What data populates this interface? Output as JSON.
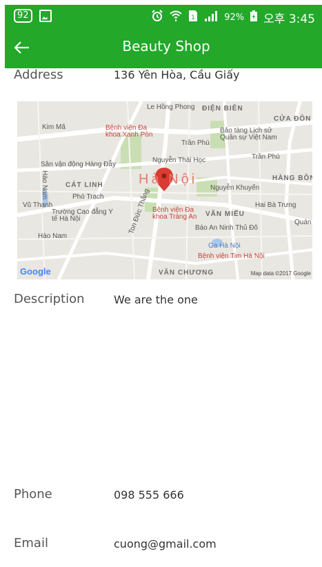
{
  "status_bar": {
    "notif_badge": "92",
    "battery_percent": "92%",
    "time": "오후 3:45"
  },
  "app_bar": {
    "title": "Beauty Shop"
  },
  "details": {
    "address_label": "Address",
    "address_value": "136 Yên Hòa, Cầu Giấy",
    "description_label": "Description",
    "description_value": "We are the one",
    "phone_label": "Phone",
    "phone_value": "098 555 666",
    "email_label": "Email",
    "email_value": "cuong@gmail.com"
  },
  "map": {
    "labels": {
      "le_hong_phong": "Le Hồng Phong",
      "dien_bien": "ĐIỆN BIÊN",
      "cua_dong": "CỬA ĐÔN",
      "kim_ma": "Kim Mã",
      "bv_xanh_pon": "Bệnh viện Đa khoa Xanh Pôn",
      "tran_phu": "Trần Phú",
      "bao_tang": "Bảo tàng Lịch sử Quân sự Việt Nam",
      "tran_phu_2": "Trần Phú",
      "nguyen_thai_hoc": "Nguyễn Thái Học",
      "san_van_dong": "Sân vận động Hàng Đẫy",
      "cat_linh": "CÁT LINH",
      "ha_noi": "Hà Nội",
      "hang_bon": "HÀNG BÔN",
      "nguyen_khuyen": "Nguyễn Khuyến",
      "hao_nam": "Hào Nam",
      "tran_hung_dao": "Ton Đức Thắng",
      "vo_thanh": "Vũ Thạnh",
      "truong_cao_dang": "Trường Cao đẳng Y tế Hà Nội",
      "bv_trang_an": "Bệnh viện Đa khoa Tràng An",
      "van_mieu": "VĂN MIẾU",
      "hai_ba_trung": "Hai Bà Trưng",
      "bao_an_ninh": "Báo An Ninh Thủ Đô",
      "quan_su": "Quán Sứ",
      "ga_ha_noi": "Ga Hà Nội",
      "bv_tim": "Bệnh viện Tim Hà Nội",
      "van_chuong": "VĂN CHƯƠNG",
      "hao_nam_2": "Hào Nam",
      "pho_trach": "Phó Trạch"
    },
    "logo": "Google",
    "attribution": "Map data ©2017 Google"
  }
}
